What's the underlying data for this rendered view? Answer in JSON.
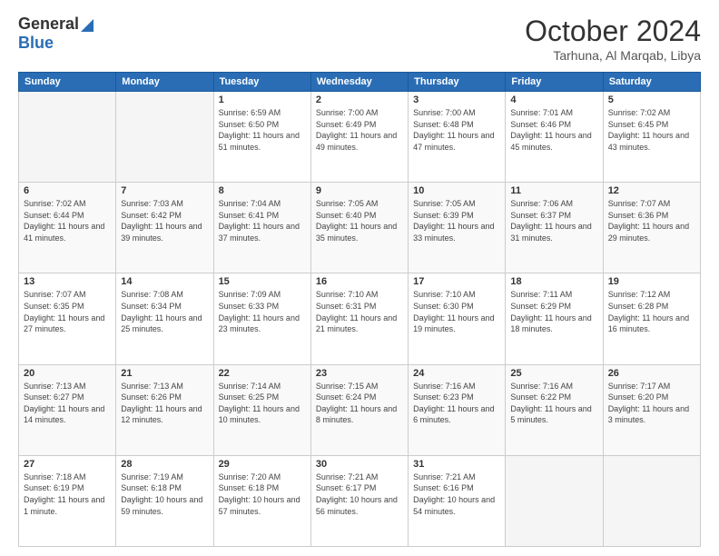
{
  "logo": {
    "general": "General",
    "blue": "Blue",
    "triangle_color": "#2a6db5"
  },
  "header": {
    "month": "October 2024",
    "location": "Tarhuna, Al Marqab, Libya"
  },
  "days_of_week": [
    "Sunday",
    "Monday",
    "Tuesday",
    "Wednesday",
    "Thursday",
    "Friday",
    "Saturday"
  ],
  "weeks": [
    [
      {
        "day": "",
        "info": ""
      },
      {
        "day": "",
        "info": ""
      },
      {
        "day": "1",
        "sunrise": "Sunrise: 6:59 AM",
        "sunset": "Sunset: 6:50 PM",
        "daylight": "Daylight: 11 hours and 51 minutes."
      },
      {
        "day": "2",
        "sunrise": "Sunrise: 7:00 AM",
        "sunset": "Sunset: 6:49 PM",
        "daylight": "Daylight: 11 hours and 49 minutes."
      },
      {
        "day": "3",
        "sunrise": "Sunrise: 7:00 AM",
        "sunset": "Sunset: 6:48 PM",
        "daylight": "Daylight: 11 hours and 47 minutes."
      },
      {
        "day": "4",
        "sunrise": "Sunrise: 7:01 AM",
        "sunset": "Sunset: 6:46 PM",
        "daylight": "Daylight: 11 hours and 45 minutes."
      },
      {
        "day": "5",
        "sunrise": "Sunrise: 7:02 AM",
        "sunset": "Sunset: 6:45 PM",
        "daylight": "Daylight: 11 hours and 43 minutes."
      }
    ],
    [
      {
        "day": "6",
        "sunrise": "Sunrise: 7:02 AM",
        "sunset": "Sunset: 6:44 PM",
        "daylight": "Daylight: 11 hours and 41 minutes."
      },
      {
        "day": "7",
        "sunrise": "Sunrise: 7:03 AM",
        "sunset": "Sunset: 6:42 PM",
        "daylight": "Daylight: 11 hours and 39 minutes."
      },
      {
        "day": "8",
        "sunrise": "Sunrise: 7:04 AM",
        "sunset": "Sunset: 6:41 PM",
        "daylight": "Daylight: 11 hours and 37 minutes."
      },
      {
        "day": "9",
        "sunrise": "Sunrise: 7:05 AM",
        "sunset": "Sunset: 6:40 PM",
        "daylight": "Daylight: 11 hours and 35 minutes."
      },
      {
        "day": "10",
        "sunrise": "Sunrise: 7:05 AM",
        "sunset": "Sunset: 6:39 PM",
        "daylight": "Daylight: 11 hours and 33 minutes."
      },
      {
        "day": "11",
        "sunrise": "Sunrise: 7:06 AM",
        "sunset": "Sunset: 6:37 PM",
        "daylight": "Daylight: 11 hours and 31 minutes."
      },
      {
        "day": "12",
        "sunrise": "Sunrise: 7:07 AM",
        "sunset": "Sunset: 6:36 PM",
        "daylight": "Daylight: 11 hours and 29 minutes."
      }
    ],
    [
      {
        "day": "13",
        "sunrise": "Sunrise: 7:07 AM",
        "sunset": "Sunset: 6:35 PM",
        "daylight": "Daylight: 11 hours and 27 minutes."
      },
      {
        "day": "14",
        "sunrise": "Sunrise: 7:08 AM",
        "sunset": "Sunset: 6:34 PM",
        "daylight": "Daylight: 11 hours and 25 minutes."
      },
      {
        "day": "15",
        "sunrise": "Sunrise: 7:09 AM",
        "sunset": "Sunset: 6:33 PM",
        "daylight": "Daylight: 11 hours and 23 minutes."
      },
      {
        "day": "16",
        "sunrise": "Sunrise: 7:10 AM",
        "sunset": "Sunset: 6:31 PM",
        "daylight": "Daylight: 11 hours and 21 minutes."
      },
      {
        "day": "17",
        "sunrise": "Sunrise: 7:10 AM",
        "sunset": "Sunset: 6:30 PM",
        "daylight": "Daylight: 11 hours and 19 minutes."
      },
      {
        "day": "18",
        "sunrise": "Sunrise: 7:11 AM",
        "sunset": "Sunset: 6:29 PM",
        "daylight": "Daylight: 11 hours and 18 minutes."
      },
      {
        "day": "19",
        "sunrise": "Sunrise: 7:12 AM",
        "sunset": "Sunset: 6:28 PM",
        "daylight": "Daylight: 11 hours and 16 minutes."
      }
    ],
    [
      {
        "day": "20",
        "sunrise": "Sunrise: 7:13 AM",
        "sunset": "Sunset: 6:27 PM",
        "daylight": "Daylight: 11 hours and 14 minutes."
      },
      {
        "day": "21",
        "sunrise": "Sunrise: 7:13 AM",
        "sunset": "Sunset: 6:26 PM",
        "daylight": "Daylight: 11 hours and 12 minutes."
      },
      {
        "day": "22",
        "sunrise": "Sunrise: 7:14 AM",
        "sunset": "Sunset: 6:25 PM",
        "daylight": "Daylight: 11 hours and 10 minutes."
      },
      {
        "day": "23",
        "sunrise": "Sunrise: 7:15 AM",
        "sunset": "Sunset: 6:24 PM",
        "daylight": "Daylight: 11 hours and 8 minutes."
      },
      {
        "day": "24",
        "sunrise": "Sunrise: 7:16 AM",
        "sunset": "Sunset: 6:23 PM",
        "daylight": "Daylight: 11 hours and 6 minutes."
      },
      {
        "day": "25",
        "sunrise": "Sunrise: 7:16 AM",
        "sunset": "Sunset: 6:22 PM",
        "daylight": "Daylight: 11 hours and 5 minutes."
      },
      {
        "day": "26",
        "sunrise": "Sunrise: 7:17 AM",
        "sunset": "Sunset: 6:20 PM",
        "daylight": "Daylight: 11 hours and 3 minutes."
      }
    ],
    [
      {
        "day": "27",
        "sunrise": "Sunrise: 7:18 AM",
        "sunset": "Sunset: 6:19 PM",
        "daylight": "Daylight: 11 hours and 1 minute."
      },
      {
        "day": "28",
        "sunrise": "Sunrise: 7:19 AM",
        "sunset": "Sunset: 6:18 PM",
        "daylight": "Daylight: 10 hours and 59 minutes."
      },
      {
        "day": "29",
        "sunrise": "Sunrise: 7:20 AM",
        "sunset": "Sunset: 6:18 PM",
        "daylight": "Daylight: 10 hours and 57 minutes."
      },
      {
        "day": "30",
        "sunrise": "Sunrise: 7:21 AM",
        "sunset": "Sunset: 6:17 PM",
        "daylight": "Daylight: 10 hours and 56 minutes."
      },
      {
        "day": "31",
        "sunrise": "Sunrise: 7:21 AM",
        "sunset": "Sunset: 6:16 PM",
        "daylight": "Daylight: 10 hours and 54 minutes."
      },
      {
        "day": "",
        "info": ""
      },
      {
        "day": "",
        "info": ""
      }
    ]
  ]
}
